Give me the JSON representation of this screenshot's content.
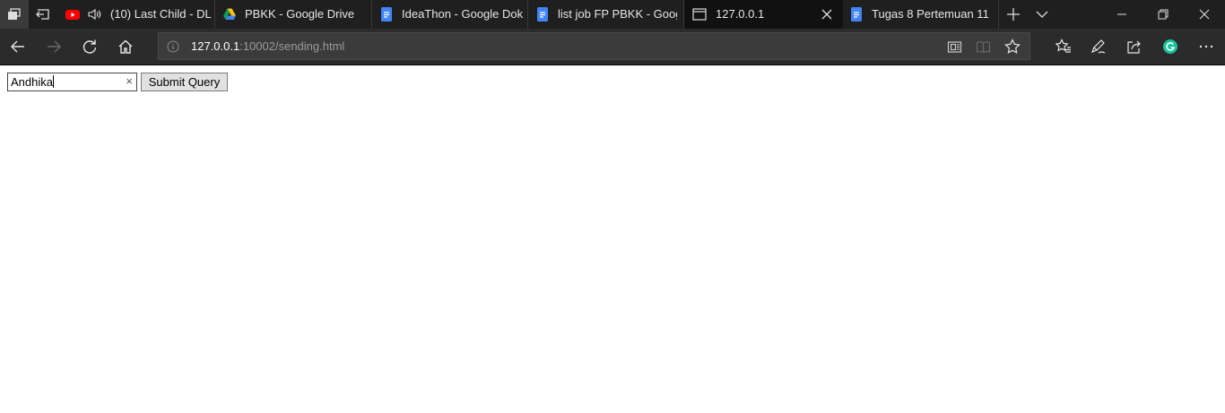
{
  "tabs": [
    {
      "title": "(10) Last Child - DL",
      "icon": "youtube-icon",
      "audio": true
    },
    {
      "title": "PBKK - Google Drive",
      "icon": "google-drive-icon"
    },
    {
      "title": "IdeaThon - Google Dok",
      "icon": "google-docs-icon"
    },
    {
      "title": "list job FP PBKK - Goog",
      "icon": "google-docs-icon"
    },
    {
      "title": "127.0.0.1",
      "icon": "page-icon",
      "active": true
    },
    {
      "title": "Tugas 8 Pertemuan 11",
      "icon": "google-docs-icon"
    }
  ],
  "address": {
    "host": "127.0.0.1",
    "path": ":10002/sending.html"
  },
  "form": {
    "input_value": "Andhika",
    "clear_glyph": "×",
    "submit_label": "Submit Query"
  },
  "colors": {
    "tabstrip": "#1f1f1f",
    "toolbar": "#2b2b2b",
    "active_tab": "#111111",
    "youtube": "#ff0000",
    "docs": "#4285f4",
    "grammarly": "#15c39a"
  }
}
